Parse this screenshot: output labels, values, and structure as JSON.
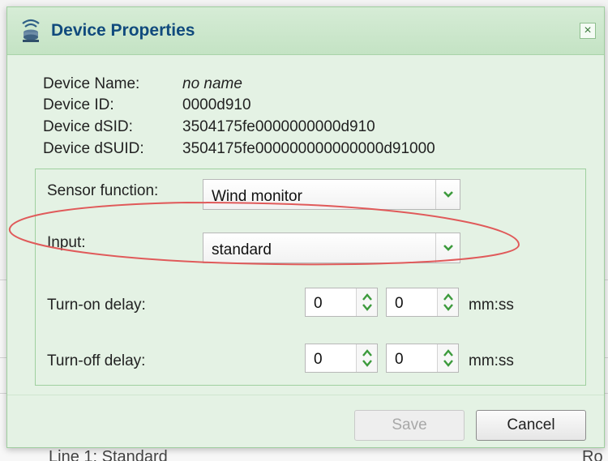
{
  "dialog": {
    "title": "Device Properties",
    "close_glyph": "×"
  },
  "info": {
    "name_label": "Device Name:",
    "name_value": "no name",
    "id_label": "Device ID:",
    "id_value": "0000d910",
    "dsid_label": "Device dSID:",
    "dsid_value": "3504175fe0000000000d910",
    "dsuid_label": "Device dSUID:",
    "dsuid_value": "3504175fe000000000000000d91000"
  },
  "form": {
    "sensor_function_label": "Sensor function:",
    "sensor_function_value": "Wind monitor",
    "input_label": "Input:",
    "input_value": "standard",
    "turn_on_label": "Turn-on delay:",
    "turn_on_mm": "0",
    "turn_on_ss": "0",
    "turn_off_label": "Turn-off delay:",
    "turn_off_mm": "0",
    "turn_off_ss": "0",
    "unit": "mm:ss"
  },
  "buttons": {
    "save": "Save",
    "cancel": "Cancel"
  },
  "background": {
    "text_left_fragment": "Line 1: Standard",
    "text_right_fragment": "Ro"
  },
  "colors": {
    "title": "#104a7d",
    "dialog_bg": "#e4f2e4",
    "annotation": "#e05a5a"
  }
}
